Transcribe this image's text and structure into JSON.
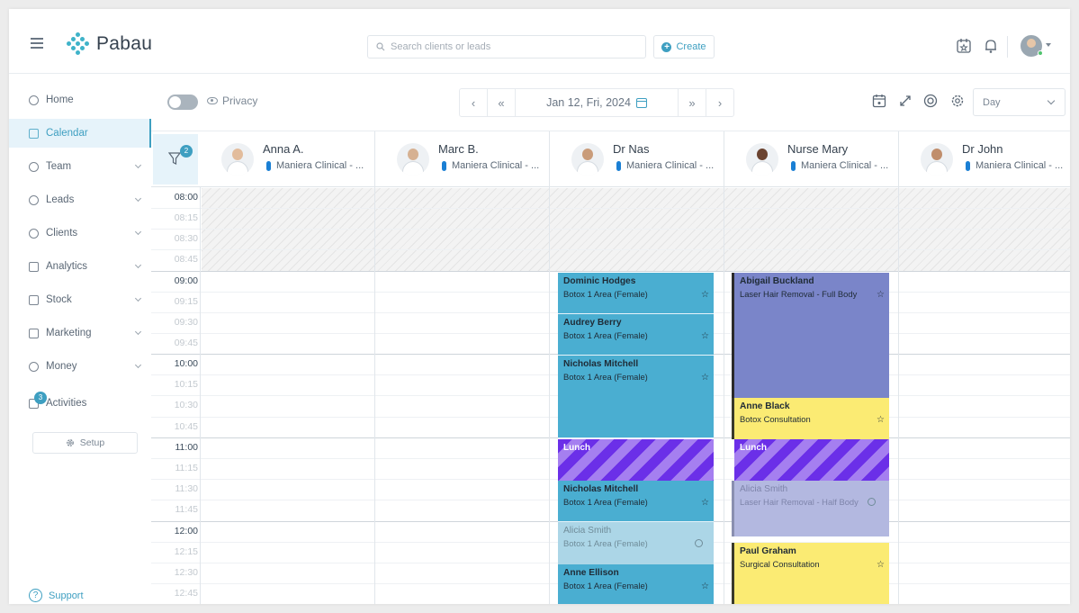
{
  "brand": {
    "name": "Pabau",
    "accent": "#3e9fc1"
  },
  "search": {
    "placeholder": "Search clients or leads"
  },
  "header": {
    "create_label": "Create"
  },
  "sidebar": {
    "items": [
      {
        "label": "Home"
      },
      {
        "label": "Calendar"
      },
      {
        "label": "Team"
      },
      {
        "label": "Leads"
      },
      {
        "label": "Clients"
      },
      {
        "label": "Analytics"
      },
      {
        "label": "Stock"
      },
      {
        "label": "Marketing"
      },
      {
        "label": "Money"
      },
      {
        "label": "Activities",
        "badge": "3"
      }
    ],
    "setup_label": "Setup",
    "support_label": "Support"
  },
  "toolbar": {
    "privacy_label": "Privacy",
    "date": "Jan 12, Fri, 2024",
    "view": "Day",
    "filter_count": "2"
  },
  "staff": [
    {
      "name": "Anna A.",
      "location": "Maniera Clinical - ..."
    },
    {
      "name": "Marc B.",
      "location": "Maniera Clinical - ..."
    },
    {
      "name": "Dr Nas",
      "location": "Maniera Clinical - ..."
    },
    {
      "name": "Nurse Mary",
      "location": "Maniera Clinical - ..."
    },
    {
      "name": "Dr John",
      "location": "Maniera Clinical - ..."
    }
  ],
  "times": [
    "08:00",
    "08:15",
    "08:30",
    "08:45",
    "09:00",
    "09:15",
    "09:30",
    "09:45",
    "10:00",
    "10:15",
    "10:30",
    "10:45",
    "11:00",
    "11:15",
    "11:30",
    "11:45",
    "12:00",
    "12:15",
    "12:30",
    "12:45"
  ],
  "appointments": [
    {
      "client": "Dominic Hodges",
      "service": "Botox 1 Area (Female)"
    },
    {
      "client": "Audrey Berry",
      "service": "Botox 1 Area (Female)"
    },
    {
      "client": "Nicholas Mitchell",
      "service": "Botox 1 Area (Female)"
    },
    {
      "client": "Lunch",
      "service": ""
    },
    {
      "client": "Nicholas Mitchell",
      "service": "Botox 1 Area (Female)"
    },
    {
      "client": "Alicia Smith",
      "service": "Botox 1 Area (Female)"
    },
    {
      "client": "Anne Ellison",
      "service": "Botox 1 Area (Female)"
    },
    {
      "client": "Abigail Buckland",
      "service": "Laser Hair Removal - Full Body"
    },
    {
      "client": "Anne Black",
      "service": "Botox Consultation"
    },
    {
      "client": "Lunch",
      "service": ""
    },
    {
      "client": "Alicia Smith",
      "service": "Laser Hair Removal - Half Body"
    },
    {
      "client": "Paul Graham",
      "service": "Surgical Consultation"
    }
  ]
}
